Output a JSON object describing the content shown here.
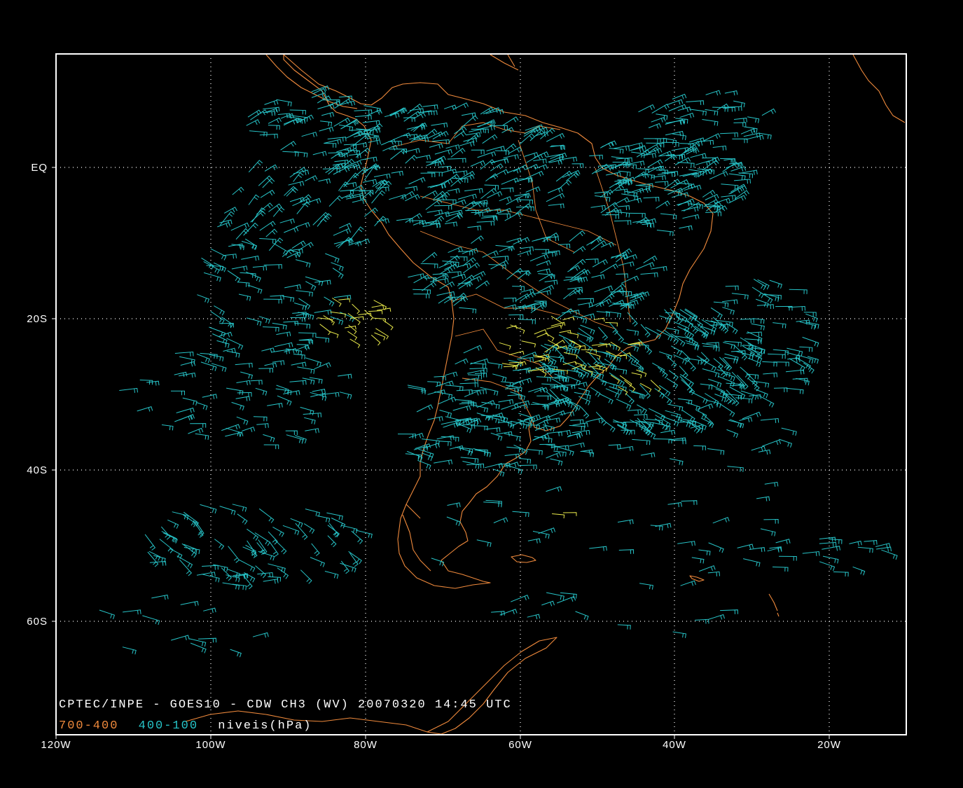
{
  "title": "CPTEC/INPE - GOES10 - CDW CH3 (WV) 20070320 14:45 UTC",
  "legend": {
    "items": [
      {
        "label": "700-400",
        "color": "#f08a3c"
      },
      {
        "label": "400-100",
        "color": "#27c4c8"
      }
    ],
    "suffix": "niveis(hPa)"
  },
  "lon_ticks": [
    "120W",
    "100W",
    "80W",
    "60W",
    "40W",
    "20W"
  ],
  "lat_ticks": [
    "EQ",
    "20S",
    "40S",
    "60S"
  ],
  "colors": {
    "background": "#000000",
    "frame": "#ffffff",
    "coastline": "#f08a3c",
    "wind_high": "#27c4c8",
    "wind_mid": "#e8e84a"
  }
}
